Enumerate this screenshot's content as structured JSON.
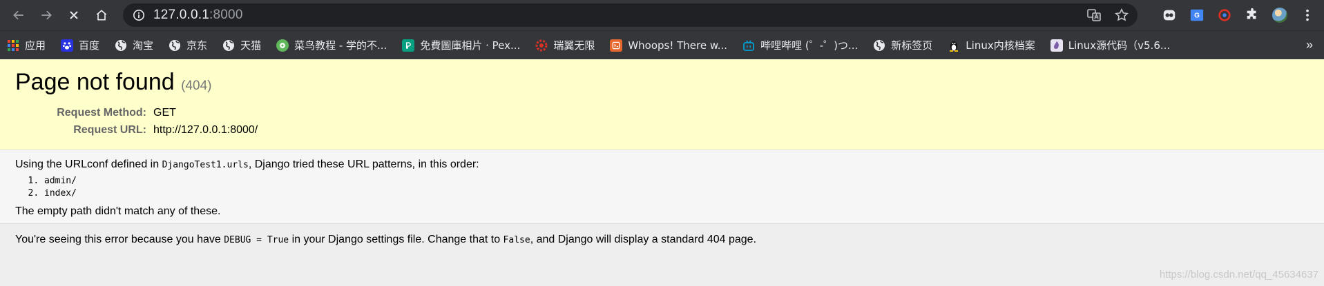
{
  "browser": {
    "url_host": "127.0.0.1",
    "url_port": ":8000"
  },
  "bookmarks": [
    {
      "label": "应用",
      "icon": "apps-grid-icon",
      "color": "#ea4335"
    },
    {
      "label": "百度",
      "icon": "baidu-paw-icon",
      "color": "#2932e1"
    },
    {
      "label": "淘宝",
      "icon": "globe-icon",
      "color": "#9aa0a6"
    },
    {
      "label": "京东",
      "icon": "globe-icon",
      "color": "#9aa0a6"
    },
    {
      "label": "天猫",
      "icon": "globe-icon",
      "color": "#9aa0a6"
    },
    {
      "label": "菜鸟教程 - 学的不...",
      "icon": "runoob-icon",
      "color": "#5fb85a"
    },
    {
      "label": "免費圖庫相片 · Pex...",
      "icon": "pexels-icon",
      "color": "#05a081"
    },
    {
      "label": "瑞翼无限",
      "icon": "gear-logo-icon",
      "color": "#d93025"
    },
    {
      "label": "Whoops! There w...",
      "icon": "whoops-icon",
      "color": "#e8672f"
    },
    {
      "label": "哔哩哔哩 (゜-゜)つ...",
      "icon": "bilibili-icon",
      "color": "#00a1d6"
    },
    {
      "label": "新标签页",
      "icon": "globe-icon",
      "color": "#9aa0a6"
    },
    {
      "label": "Linux内核档案",
      "icon": "tux-icon",
      "color": "#f2c300"
    },
    {
      "label": "Linux源代码（v5.6...",
      "icon": "elixir-icon",
      "color": "#7b5ea7"
    }
  ],
  "page": {
    "title": "Page not found",
    "code": "(404)",
    "meta": [
      {
        "key": "Request Method:",
        "value": "GET"
      },
      {
        "key": "Request URL:",
        "value": "http://127.0.0.1:8000/"
      }
    ],
    "urlconf_prefix": "Using the URLconf defined in ",
    "urlconf_module": "DjangoTest1.urls",
    "urlconf_suffix": ", Django tried these URL patterns, in this order:",
    "patterns": [
      "admin/",
      "index/"
    ],
    "no_match": "The empty path didn't match any of these.",
    "explanation_1": "You're seeing this error because you have ",
    "explanation_code1": "DEBUG = True",
    "explanation_2": " in your Django settings file. Change that to ",
    "explanation_code2": "False",
    "explanation_3": ", and Django will display a standard 404 page."
  },
  "watermark": "https://blog.csdn.net/qq_45634637"
}
